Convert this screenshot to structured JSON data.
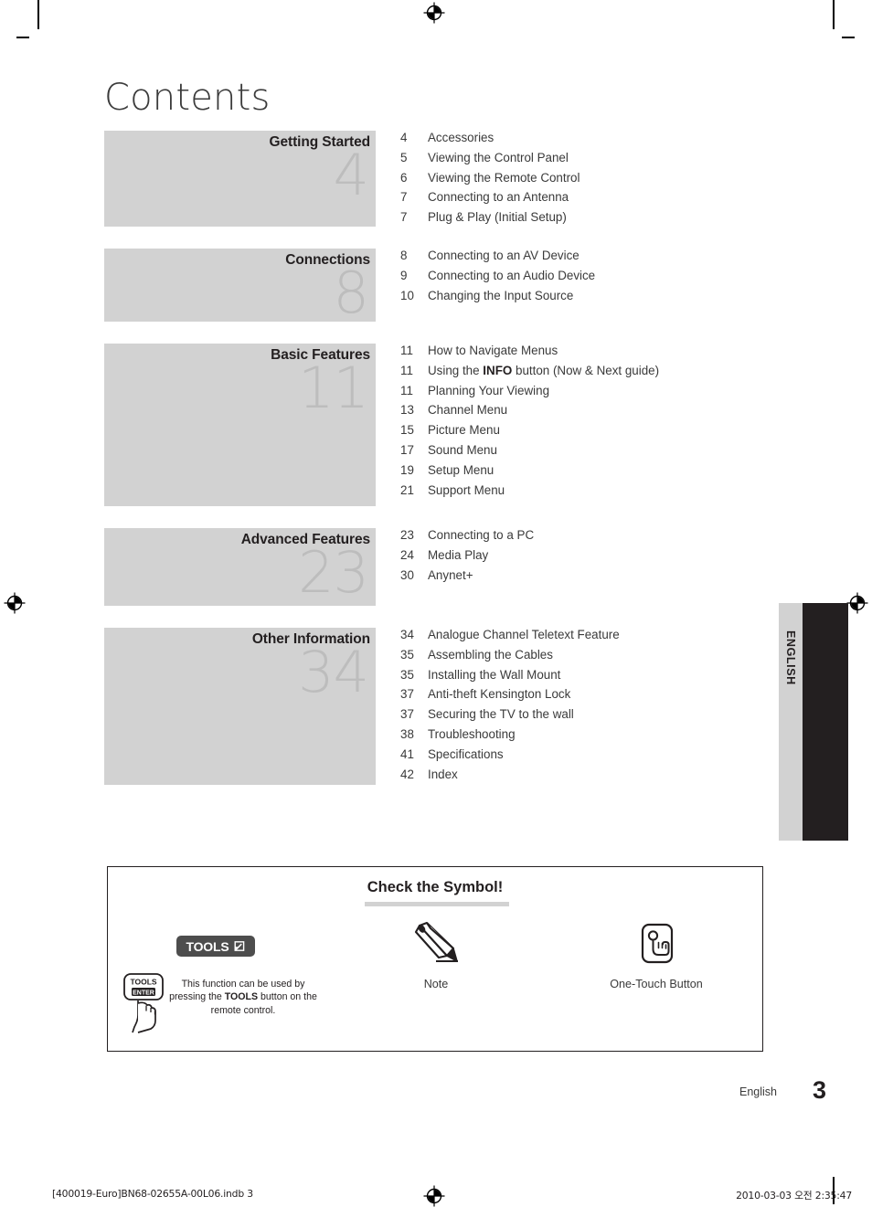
{
  "page": {
    "title": "Contents",
    "language_tab": "ENGLISH",
    "footer_language": "English",
    "footer_page_number": "3",
    "print_footer_left": "[400019-Euro]BN68-02655A-00L06.indb   3",
    "print_footer_right": "2010-03-03   오전 2:35:47"
  },
  "colors": {
    "block_gray": "#d2d2d2",
    "block_number_gray": "#bdbdbd",
    "text_dark": "#231f20",
    "tab_dark": "#231f20",
    "badge_gray": "#4d4d4d"
  },
  "sections": [
    {
      "title": "Getting Started",
      "number": "4",
      "block_height": 105,
      "entries": [
        {
          "page": "4",
          "title": "Accessories"
        },
        {
          "page": "5",
          "title": "Viewing the Control Panel"
        },
        {
          "page": "6",
          "title": "Viewing the Remote Control"
        },
        {
          "page": "7",
          "title": "Connecting to an Antenna"
        },
        {
          "page": "7",
          "title": "Plug & Play (Initial Setup)"
        }
      ]
    },
    {
      "title": "Connections",
      "number": "8",
      "block_height": 80,
      "entries": [
        {
          "page": "8",
          "title": "Connecting to an AV Device"
        },
        {
          "page": "9",
          "title": "Connecting to an Audio Device"
        },
        {
          "page": "10",
          "title": "Changing the Input Source"
        }
      ]
    },
    {
      "title": "Basic Features",
      "number": "11",
      "block_height": 178,
      "entries": [
        {
          "page": "11",
          "title": "How to Navigate Menus"
        },
        {
          "page": "11",
          "title": "Using the INFO button (Now & Next guide)",
          "bold_part": "INFO"
        },
        {
          "page": "11",
          "title": "Planning Your Viewing"
        },
        {
          "page": "13",
          "title": "Channel Menu"
        },
        {
          "page": "15",
          "title": "Picture Menu"
        },
        {
          "page": "17",
          "title": "Sound Menu"
        },
        {
          "page": "19",
          "title": "Setup Menu"
        },
        {
          "page": "21",
          "title": "Support Menu"
        }
      ]
    },
    {
      "title": "Advanced Features",
      "number": "23",
      "block_height": 85,
      "entries": [
        {
          "page": "23",
          "title": "Connecting to a PC"
        },
        {
          "page": "24",
          "title": "Media Play"
        },
        {
          "page": "30",
          "title": "Anynet+"
        }
      ]
    },
    {
      "title": "Other Information",
      "number": "34",
      "block_height": 172,
      "entries": [
        {
          "page": "34",
          "title": "Analogue Channel Teletext Feature"
        },
        {
          "page": "35",
          "title": "Assembling the Cables"
        },
        {
          "page": "35",
          "title": "Installing the Wall Mount"
        },
        {
          "page": "37",
          "title": "Anti-theft Kensington Lock"
        },
        {
          "page": "37",
          "title": "Securing the TV to the wall"
        },
        {
          "page": "38",
          "title": "Troubleshooting"
        },
        {
          "page": "41",
          "title": "Specifications"
        },
        {
          "page": "42",
          "title": "Index"
        }
      ]
    }
  ],
  "symbol_box": {
    "heading": "Check the Symbol!",
    "items": [
      {
        "icon": "tools-badge-icon",
        "badge_label": "TOOLS",
        "caption_html": "This function can be used by pressing the TOOLS button on the remote control.",
        "caption_line1": "This function can be used by",
        "caption_line2_pre": "pressing the ",
        "caption_line2_bold": "TOOLS",
        "caption_line2_post": " button on the",
        "caption_line3": "remote control.",
        "remote_key_label": "TOOLS"
      },
      {
        "icon": "pencil-icon",
        "caption": "Note"
      },
      {
        "icon": "one-touch-button-icon",
        "caption": "One-Touch Button"
      }
    ]
  }
}
